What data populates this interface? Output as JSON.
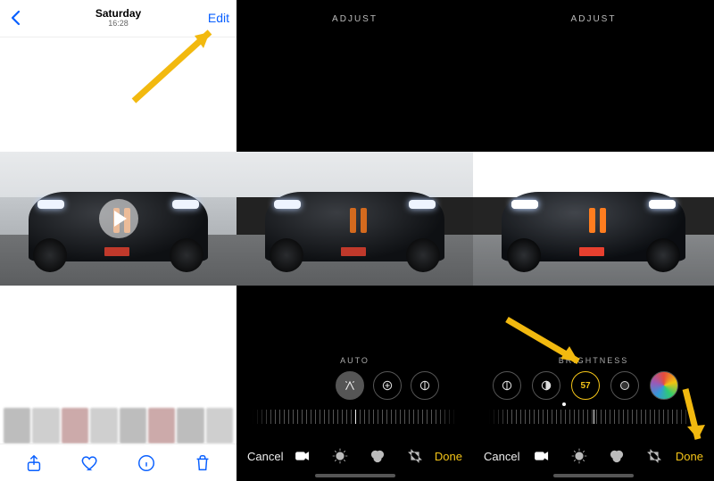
{
  "screen1": {
    "header": {
      "day": "Saturday",
      "time": "16:28",
      "edit": "Edit"
    },
    "toolbar": {
      "share": "share-icon",
      "favorite": "heart-icon",
      "info": "info-icon",
      "delete": "trash-icon"
    }
  },
  "screen2": {
    "header": "ADJUST",
    "adjust_label": "AUTO",
    "cancel": "Cancel",
    "done": "Done"
  },
  "screen3": {
    "header": "ADJUST",
    "adjust_label": "BRIGHTNESS",
    "brightness_value": "57",
    "cancel": "Cancel",
    "done": "Done"
  },
  "colors": {
    "ios_blue": "#0a60ff",
    "ios_yellow": "#f5c518",
    "arrow": "#f2b90f"
  }
}
